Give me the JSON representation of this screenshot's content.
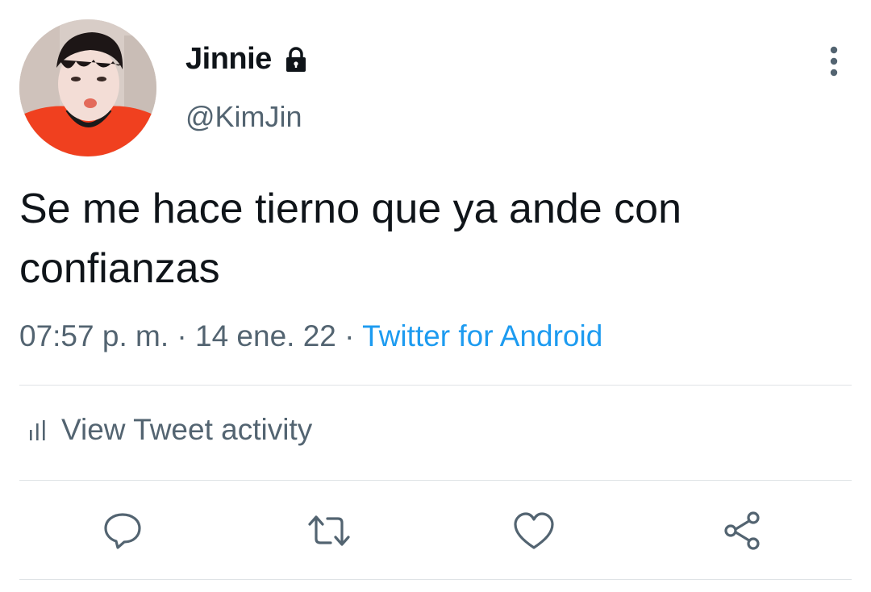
{
  "author": {
    "display_name": "Jinnie",
    "handle": "@KimJin",
    "avatar_icon": "avatar-photo",
    "protected_icon": "lock-icon"
  },
  "tweet": {
    "text": "Se me hace tierno que ya ande con confianzas",
    "time": "07:57 p. m.",
    "separator": "·",
    "date": "14 ene. 22",
    "source": "Twitter for Android"
  },
  "activity": {
    "label": "View Tweet activity",
    "icon": "bar-chart-icon"
  },
  "actions": {
    "reply_icon": "reply-icon",
    "retweet_icon": "retweet-icon",
    "like_icon": "heart-icon",
    "share_icon": "share-icon",
    "more_icon": "more-vertical-icon"
  },
  "colors": {
    "text": "#0f1419",
    "secondary": "#536471",
    "link": "#1d9bf0",
    "divider": "#dfe3e6"
  }
}
